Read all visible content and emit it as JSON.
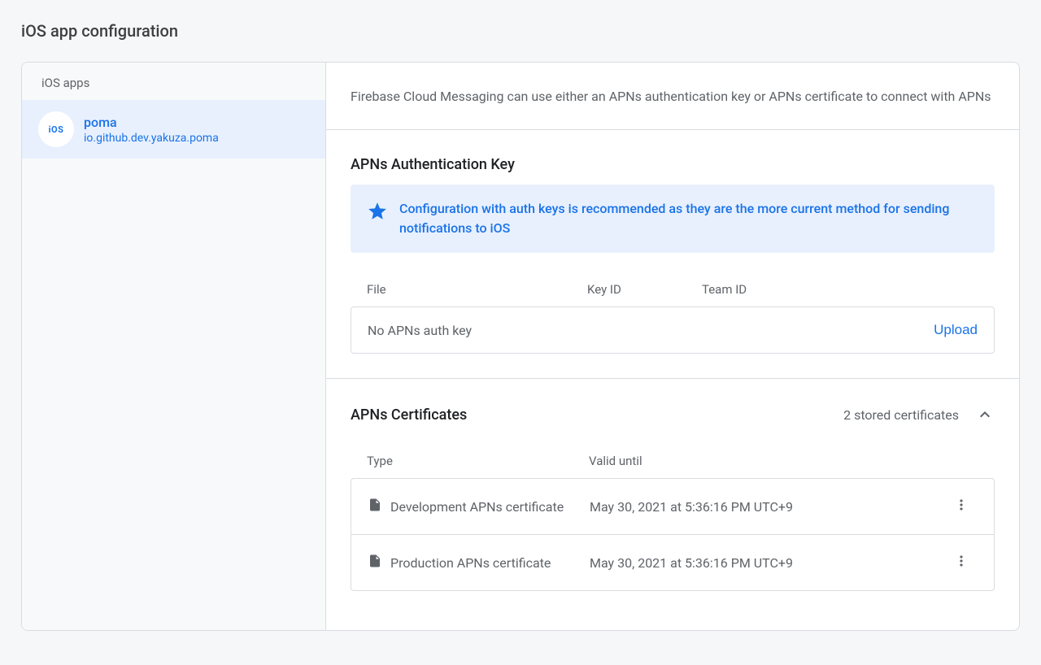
{
  "page": {
    "title": "iOS app configuration"
  },
  "sidebar": {
    "header": "iOS apps",
    "app": {
      "icon_label": "iOS",
      "name": "poma",
      "bundle_id": "io.github.dev.yakuza.poma"
    }
  },
  "content": {
    "intro": "Firebase Cloud Messaging can use either an APNs authentication key or APNs certificate to connect with APNs",
    "auth_key": {
      "title": "APNs Authentication Key",
      "banner": "Configuration with auth keys is recommended as they are the more current method for sending notifications to iOS",
      "columns": {
        "file": "File",
        "key_id": "Key ID",
        "team_id": "Team ID"
      },
      "empty_text": "No APNs auth key",
      "upload_label": "Upload"
    },
    "certificates": {
      "title": "APNs Certificates",
      "count_text": "2 stored certificates",
      "columns": {
        "type": "Type",
        "valid_until": "Valid until"
      },
      "rows": [
        {
          "type": "Development APNs certificate",
          "valid_until": "May 30, 2021 at 5:36:16 PM UTC+9"
        },
        {
          "type": "Production APNs certificate",
          "valid_until": "May 30, 2021 at 5:36:16 PM UTC+9"
        }
      ]
    }
  }
}
